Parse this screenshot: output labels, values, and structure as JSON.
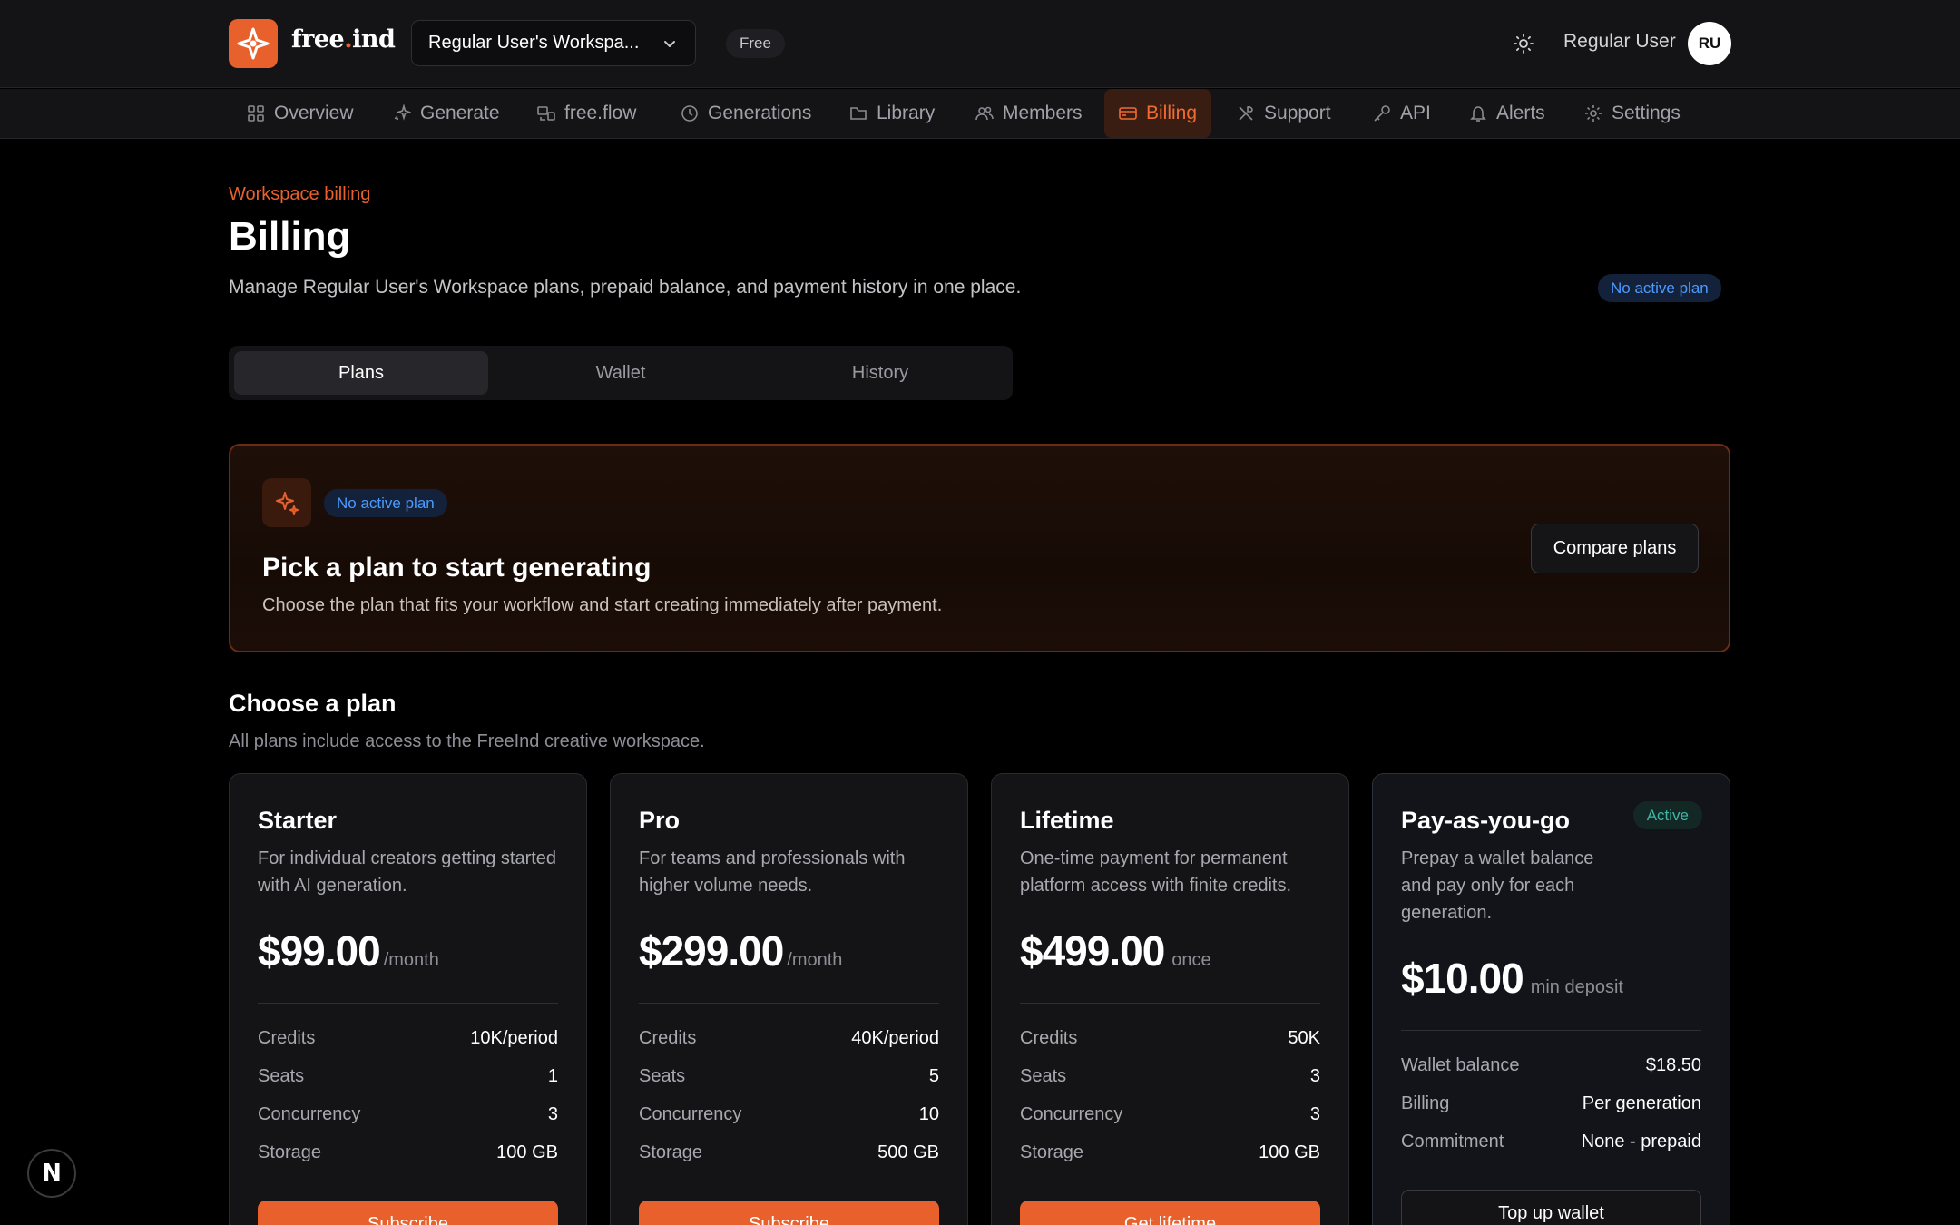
{
  "header": {
    "logo_text_a": "free",
    "logo_text_dot": ".",
    "logo_text_b": "ind",
    "workspace_name": "Regular User's Workspa...",
    "plan_pill": "Free",
    "user_name": "Regular User",
    "avatar_initials": "RU"
  },
  "nav": {
    "items": [
      {
        "label": "Overview",
        "icon": "grid-icon"
      },
      {
        "label": "Generate",
        "icon": "sparkle-icon"
      },
      {
        "label": "free.flow",
        "icon": "flow-icon"
      },
      {
        "label": "Generations",
        "icon": "clock-icon"
      },
      {
        "label": "Library",
        "icon": "folder-icon"
      },
      {
        "label": "Members",
        "icon": "users-icon"
      },
      {
        "label": "Billing",
        "icon": "card-icon",
        "active": true
      },
      {
        "label": "Support",
        "icon": "tools-icon"
      },
      {
        "label": "API",
        "icon": "key-icon"
      },
      {
        "label": "Alerts",
        "icon": "bell-icon"
      },
      {
        "label": "Settings",
        "icon": "gear-icon"
      }
    ]
  },
  "page": {
    "eyebrow": "Workspace billing",
    "title": "Billing",
    "subtitle": "Manage Regular User's Workspace plans, prepaid balance, and payment history in one place.",
    "status_badge": "No active plan"
  },
  "tabs": [
    {
      "label": "Plans",
      "active": true
    },
    {
      "label": "Wallet"
    },
    {
      "label": "History"
    }
  ],
  "hero": {
    "badge": "No active plan",
    "title": "Pick a plan to start generating",
    "description": "Choose the plan that fits your workflow and start creating immediately after payment.",
    "compare_label": "Compare plans"
  },
  "plans_section": {
    "title": "Choose a plan",
    "subtitle": "All plans include access to the FreeInd creative workspace."
  },
  "plans": [
    {
      "name": "Starter",
      "description": "For individual creators getting started with AI generation.",
      "price": "$99.00",
      "period": "/month",
      "specs": [
        {
          "k": "Credits",
          "v": "10K/period"
        },
        {
          "k": "Seats",
          "v": "1"
        },
        {
          "k": "Concurrency",
          "v": "3"
        },
        {
          "k": "Storage",
          "v": "100 GB"
        }
      ],
      "cta": "Subscribe"
    },
    {
      "name": "Pro",
      "description": "For teams and professionals with higher volume needs.",
      "price": "$299.00",
      "period": "/month",
      "specs": [
        {
          "k": "Credits",
          "v": "40K/period"
        },
        {
          "k": "Seats",
          "v": "5"
        },
        {
          "k": "Concurrency",
          "v": "10"
        },
        {
          "k": "Storage",
          "v": "500 GB"
        }
      ],
      "cta": "Subscribe"
    },
    {
      "name": "Lifetime",
      "description": "One-time payment for permanent platform access with finite credits.",
      "price": "$499.00",
      "period": "once",
      "specs": [
        {
          "k": "Credits",
          "v": "50K"
        },
        {
          "k": "Seats",
          "v": "3"
        },
        {
          "k": "Concurrency",
          "v": "3"
        },
        {
          "k": "Storage",
          "v": "100 GB"
        }
      ],
      "cta": "Get lifetime"
    },
    {
      "name": "Pay-as-you-go",
      "badge": "Active",
      "description": "Prepay a wallet balance and pay only for each generation.",
      "price": "$10.00",
      "period": "min deposit",
      "specs": [
        {
          "k": "Wallet balance",
          "v": "$18.50"
        },
        {
          "k": "Billing",
          "v": "Per generation"
        },
        {
          "k": "Commitment",
          "v": "None - prepaid"
        }
      ],
      "cta": "Top up wallet"
    }
  ],
  "dev_badge": "N",
  "colors": {
    "accent": "#e8612c",
    "background": "#000000",
    "surface": "#141416",
    "info_blue": "#4b9bff",
    "active_teal": "#3fb7a6"
  }
}
